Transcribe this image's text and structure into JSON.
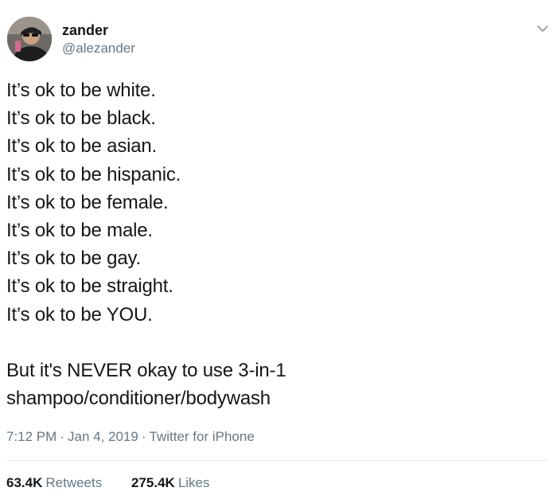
{
  "tweet": {
    "author": {
      "display_name": "zander",
      "handle": "@alezander"
    },
    "icons": {
      "avatar": "profile-photo",
      "menu": "chevron-down-icon"
    },
    "lines": [
      "It’s ok to be white.",
      "It’s ok to be black.",
      "It’s ok to be asian.",
      "It’s ok to be hispanic.",
      "It’s ok to be female.",
      "It’s ok to be male.",
      "It’s ok to be gay.",
      "It’s ok to be straight.",
      "It’s ok to be YOU."
    ],
    "closing_lines": [
      "But it's NEVER okay to use 3-in-1",
      "shampoo/conditioner/bodywash"
    ],
    "meta": {
      "time": "7:12 PM",
      "separator": "·",
      "date": "Jan 4, 2019",
      "source": "Twitter for iPhone"
    },
    "stats": {
      "retweets_count": "63.4K",
      "retweets_label": "Retweets",
      "likes_count": "275.4K",
      "likes_label": "Likes"
    },
    "colors": {
      "text": "#14171a",
      "secondary": "#657786",
      "divider": "#e6ecf0",
      "caret": "#8899a6"
    }
  }
}
